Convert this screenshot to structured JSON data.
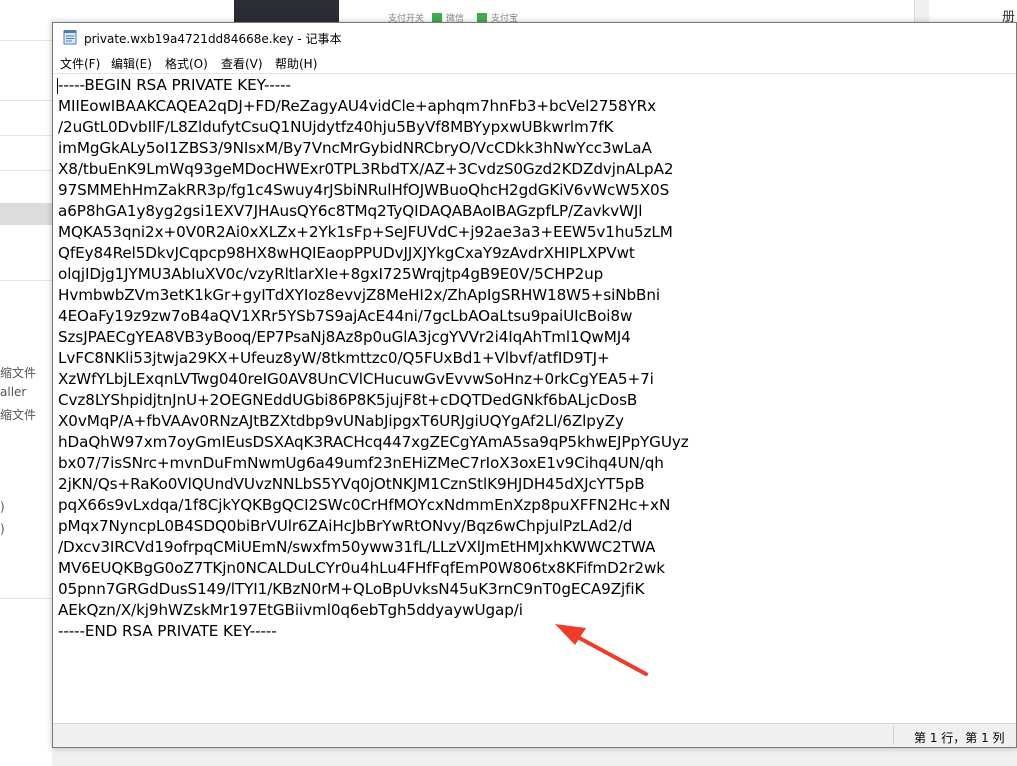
{
  "background": {
    "left_texts": [
      "缩文件",
      "aller",
      "缩文件",
      ")",
      ")"
    ],
    "top_toggles": [
      "支付开关",
      "微信",
      "支付宝"
    ],
    "right_text": "册"
  },
  "window": {
    "title": "private.wxb19a4721dd84668e.key - 记事本",
    "icon": "notepad-icon"
  },
  "menu": [
    {
      "label": "文件(F)"
    },
    {
      "label": "编辑(E)"
    },
    {
      "label": "格式(O)"
    },
    {
      "label": "查看(V)"
    },
    {
      "label": "帮助(H)"
    }
  ],
  "document": {
    "lines": [
      "-----BEGIN RSA PRIVATE KEY-----",
      "MIIEowIBAAKCAQEA2qDJ+FD/ReZagyAU4vidCle+aphqm7hnFb3+bcVel2758YRx",
      "/2uGtL0DvbIlF/L8ZldufytCsuQ1NUjdytfz40hju5ByVf8MBYypxwUBkwrlm7fK",
      "imMgGkALy5oI1ZBS3/9NIsxM/By7VncMrGybidNRCbryO/VcCDkk3hNwYcc3wLaA",
      "X8/tbuEnK9LmWq93geMDocHWExr0TPL3RbdTX/AZ+3CvdzS0Gzd2KDZdvjnALpA2",
      "97SMMEhHmZakRR3p/fg1c4Swuy4rJSbiNRulHfOJWBuoQhcH2gdGKiV6vWcW5X0S",
      "a6P8hGA1y8yg2gsi1EXV7JHAusQY6c8TMq2TyQIDAQABAoIBAGzpfLP/ZavkvWJl",
      "MQKA53qni2x+0V0R2Ai0xXLZx+2Yk1sFp+SeJFUVdC+j92ae3a3+EEW5v1hu5zLM",
      "QfEy84Rel5DkvJCqpcp98HX8wHQIEaopPPUDvJJXJYkgCxaY9zAvdrXHIPLXPVwt",
      "olqjIDjg1JYMU3AbIuXV0c/vzyRltlarXIe+8gxI725Wrqjtp4gB9E0V/5CHP2up",
      "HvmbwbZVm3etK1kGr+gyITdXYIoz8evvjZ8MeHI2x/ZhApIgSRHW18W5+siNbBni",
      "4EOaFy19z9zw7oB4aQV1XRr5YSb7S9ajAcE44ni/7gcLbAOaLtsu9paiUIcBoi8w",
      "SzsJPAECgYEA8VB3yBooq/EP7PsaNj8Az8p0uGlA3jcgYVVr2i4IqAhTml1QwMJ4",
      "LvFC8NKli53jtwja29KX+Ufeuz8yW/8tkmttzc0/Q5FUxBd1+Vlbvf/atfID9TJ+",
      "XzWfYLbjLExqnLVTwg040reIG0AV8UnCVlCHucuwGvEvvwSoHnz+0rkCgYEA5+7i",
      "Cvz8LYShpidjtnJnU+2OEGNEddUGbi86P8K5jujF8t+cDQTDedGNkf6bALjcDosB",
      "X0vMqP/A+fbVAAv0RNzAJtBZXtdbp9vUNabJipgxT6URJgiUQYgAf2Ll/6ZlpyZy",
      "hDaQhW97xm7oyGmIEusDSXAqK3RACHcq447xgZECgYAmA5sa9qP5khwEJPpYGUyz",
      "bx07/7isSNrc+mvnDuFmNwmUg6a49umf23nEHiZMeC7rIoX3oxE1v9Cihq4UN/qh",
      "2jKN/Qs+RaKo0VlQUndVUvzNNLbS5YVq0jOtNKJM1CznStlK9HJDH45dXJcYT5pB",
      "pqX66s9vLxdqa/1f8CjkYQKBgQCI2SWc0CrHfMOYcxNdmmEnXzp8puXFFN2Hc+xN",
      "pMqx7NyncpL0B4SDQ0biBrVUlr6ZAiHcJbBrYwRtONvy/Bqz6wChpjulPzLAd2/d",
      "/Dxcv3IRCVd19ofrpqCMiUEmN/swxfm50yww31fL/LLzVXlJmEtHMJxhKWWC2TWA",
      "MV6EUQKBgG0oZ7TKjn0NCALDuLCYr0u4hLu4FHfFqfEmP0W806tx8KFifmD2r2wk",
      "05pnn7GRGdDusS149/lTYI1/KBzN0rM+QLoBpUvksN45uK3rnC9nT0gECA9ZjfiK",
      "AEkQzn/X/kj9hWZskMr197EtGBiivml0q6ebTgh5ddyaywUgap/i",
      "-----END RSA PRIVATE KEY-----"
    ]
  },
  "status": {
    "position": "第 1 行，第 1 列"
  },
  "annotation": {
    "color": "#f03a2a",
    "icon": "red-arrow-annotation"
  }
}
